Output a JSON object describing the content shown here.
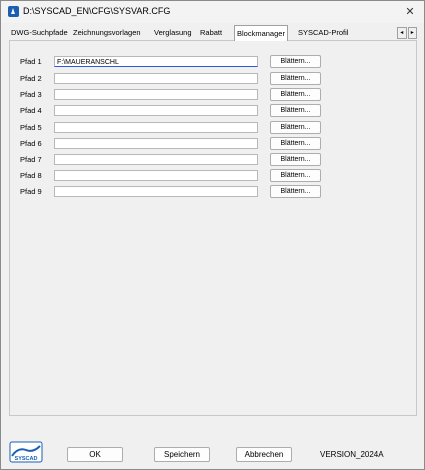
{
  "window": {
    "title": "D:\\SYSCAD_EN\\CFG\\SYSVAR.CFG",
    "close_glyph": "✕"
  },
  "tabs": [
    {
      "label": "DWG-Suchpfade"
    },
    {
      "label": "Zeichnungsvorlagen"
    },
    {
      "label": "Verglasung"
    },
    {
      "label": "Rabatt"
    },
    {
      "label": "Blockmanager",
      "active": true
    },
    {
      "label": "SYSCAD-Profil"
    }
  ],
  "tab_scroll": {
    "left": "◂",
    "right": "▸"
  },
  "paths": [
    {
      "label": "Pfad 1",
      "value": "F:\\MAUERANSCHL",
      "button": "Blättern..."
    },
    {
      "label": "Pfad 2",
      "value": "",
      "button": "Blättern..."
    },
    {
      "label": "Pfad 3",
      "value": "",
      "button": "Blättern..."
    },
    {
      "label": "Pfad 4",
      "value": "",
      "button": "Blättern..."
    },
    {
      "label": "Pfad 5",
      "value": "",
      "button": "Blättern..."
    },
    {
      "label": "Pfad 6",
      "value": "",
      "button": "Blättern..."
    },
    {
      "label": "Pfad 7",
      "value": "",
      "button": "Blättern..."
    },
    {
      "label": "Pfad 8",
      "value": "",
      "button": "Blättern..."
    },
    {
      "label": "Pfad 9",
      "value": "",
      "button": "Blättern..."
    }
  ],
  "footer": {
    "logo_text": "SYSCAD",
    "ok": "OK",
    "save": "Speichern",
    "cancel": "Abbrechen",
    "version": "VERSION_2024A"
  },
  "colors": {
    "accent": "#2a5bd7",
    "logo": "#1a5fb4"
  }
}
